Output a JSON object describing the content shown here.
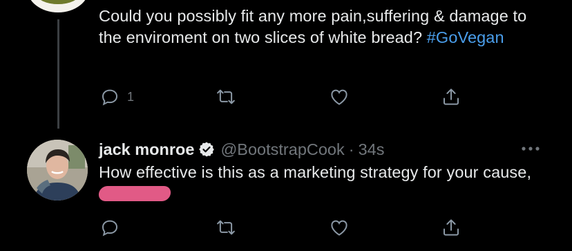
{
  "tweet1": {
    "text": "Could you possibly fit any more pain,suffering & damage to the enviroment on two slices of white bread?",
    "hashtag": "#GoVegan",
    "reply_count": "1"
  },
  "tweet2": {
    "name": "jack monroe",
    "handle": "@BootstrapCook",
    "separator": "·",
    "time": "34s",
    "text": "How effective is this as a marketing strategy for your cause,"
  },
  "icons": [
    "reply-icon",
    "retweet-icon",
    "like-icon",
    "share-icon",
    "verified-icon",
    "more-icon"
  ],
  "colors": {
    "background": "#000000",
    "text": "#e7e9ea",
    "muted": "#71767b",
    "link": "#4a9eeb",
    "redaction": "#e15a86"
  }
}
